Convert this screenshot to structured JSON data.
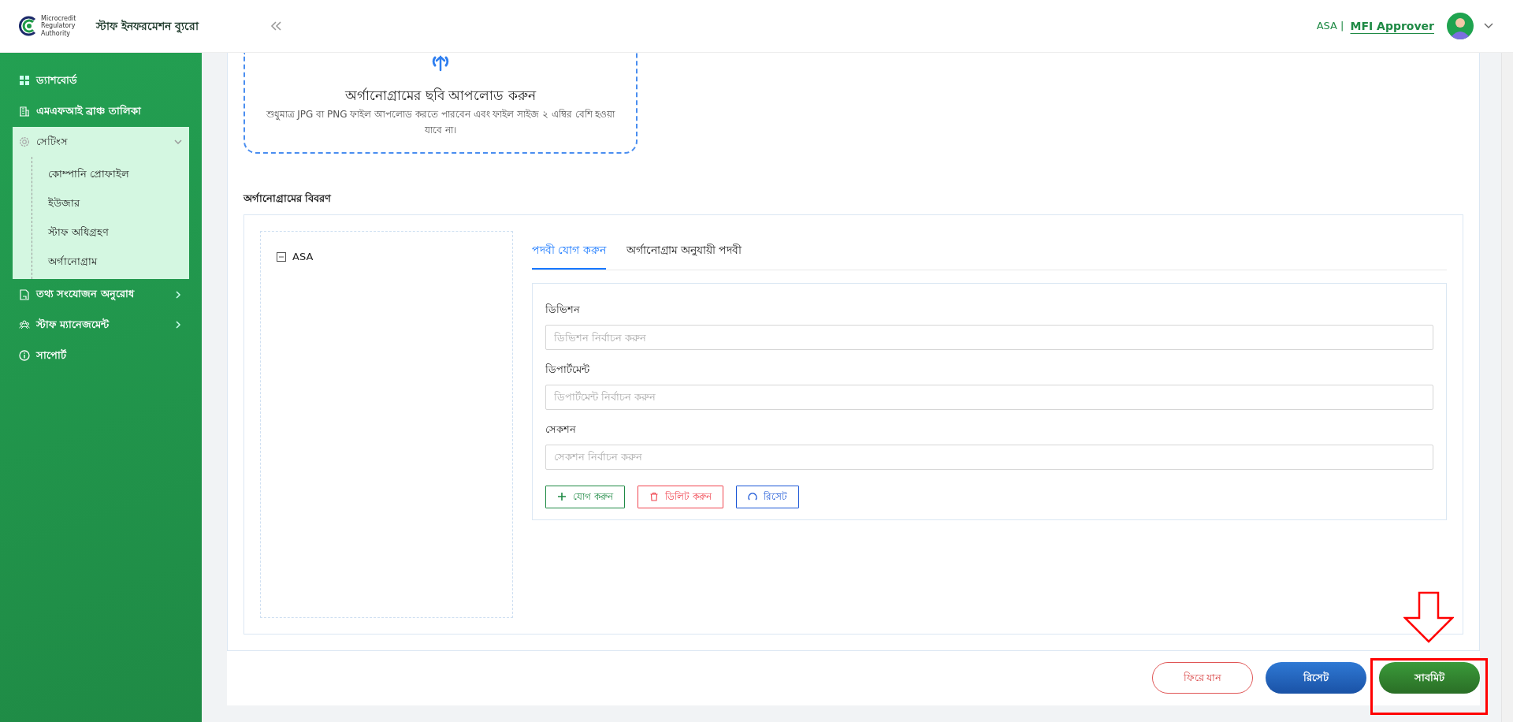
{
  "header": {
    "logo_text": "Microcredit Regulatory Authority",
    "app_title": "স্টাফ ইনফরমেশন ব্যুরো",
    "org": "ASA |",
    "role": "MFI Approver"
  },
  "sidebar": {
    "items": [
      {
        "label": "ড্যাশবোর্ড",
        "selected": false
      },
      {
        "label": "এমএফআই ব্রাঞ্চ তালিকা",
        "selected": false
      },
      {
        "label": "সেটিংস",
        "selected": false,
        "expanded": true,
        "children": [
          {
            "label": "কোম্পানি প্রোফাইল",
            "selected": false
          },
          {
            "label": "ইউজার",
            "selected": false
          },
          {
            "label": "স্টাফ অধিগ্রহণ",
            "selected": false
          },
          {
            "label": "অর্গানোগ্রাম",
            "selected": false
          }
        ]
      },
      {
        "label": "তথ্য সংযোজন অনুরোধ",
        "selected": false,
        "expanded": false
      },
      {
        "label": "স্টাফ ম্যানেজমেন্ট",
        "selected": false,
        "expanded": false
      },
      {
        "label": "সাপোর্ট",
        "selected": false
      }
    ]
  },
  "upload": {
    "title": "অর্গানোগ্রামের ছবি আপলোড করুন",
    "hint": "শুধুমাত্র JPG বা PNG ফাইল আপলোড করতে পারবেন এবং ফাইল সাইজ ২ এম্বির বেশি হওয়া যাবে না।"
  },
  "organogram": {
    "heading": "অর্গানোগ্রামের বিবরণ",
    "tree": [
      {
        "label": "ASA",
        "expanded": true
      }
    ],
    "tabs": [
      {
        "label": "পদবী যোগ করুন",
        "selected": true
      },
      {
        "label": "অর্গানোগ্রাম অনুযায়ী পদবী",
        "selected": false
      }
    ],
    "fields": [
      {
        "label": "ডিভিশন",
        "placeholder": "ডিভিশন নির্বাচন করুন"
      },
      {
        "label": "ডিপার্টমেন্ট",
        "placeholder": "ডিপার্টমেন্ট নির্বাচন করুন"
      },
      {
        "label": "সেকশন",
        "placeholder": "সেকশন নির্বাচন করুন"
      }
    ],
    "actions": [
      {
        "kind": "add",
        "label": "যোগ করুন"
      },
      {
        "kind": "delete",
        "label": "ডিলিট করুন"
      },
      {
        "kind": "reset",
        "label": "রিসেট"
      }
    ]
  },
  "footer_buttons": [
    {
      "kind": "back",
      "label": "ফিরে যান"
    },
    {
      "kind": "reset",
      "label": "রিসেট"
    },
    {
      "kind": "submit",
      "label": "সাবমিট"
    }
  ]
}
